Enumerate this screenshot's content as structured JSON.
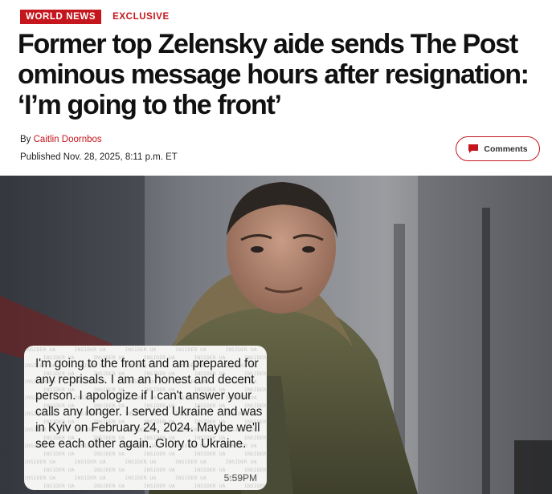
{
  "header": {
    "section_tag": "WORLD NEWS",
    "exclusive_tag": "EXCLUSIVE",
    "headline": "Former top Zelensky aide sends The Post ominous message hours after resignation: ‘I’m going to the front’"
  },
  "meta": {
    "by_prefix": "By ",
    "author": "Caitlin Doornbos",
    "published": "Published Nov. 28, 2025, 8:11 p.m. ET"
  },
  "actions": {
    "comments_label": "Comments"
  },
  "image": {
    "text_message": "I'm going to the front and am prepared for any reprisals. I am an honest and decent person. I apologize if I can't answer your calls any longer. I served Ukraine and was in Kyiv on February 24, 2024. Maybe we'll see each other again. Glory to Ukraine.",
    "message_time": "5:59PM",
    "watermark_text": "INSIDER UA"
  },
  "colors": {
    "brand_red": "#c4161c",
    "headline": "#111111",
    "bubble_bg": "#f4f4f2"
  },
  "icons": {
    "comments": "speech-bubble-icon"
  }
}
